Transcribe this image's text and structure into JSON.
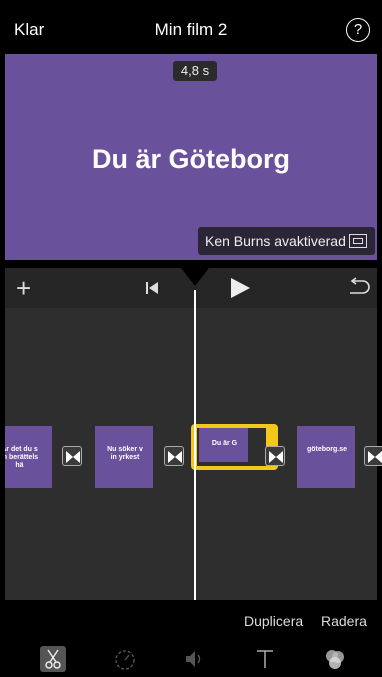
{
  "header": {
    "done_label": "Klar",
    "title": "Min film 2",
    "help_label": "?"
  },
  "preview": {
    "duration": "4,8 s",
    "title_text": "Du är Göteborg",
    "ken_burns_label": "Ken Burns avaktiverad",
    "background_color": "#6a519b"
  },
  "timeline": {
    "clips": [
      {
        "text": "Är det du s\nin berättels\nhä"
      },
      {
        "text": "Nu söker v\nin yrkest"
      },
      {
        "text": "Du är G"
      },
      {
        "text": "göteborg.se"
      }
    ],
    "selected_clip_index": 2,
    "selection_color": "#f3c81c"
  },
  "actions": {
    "duplicate_label": "Duplicera",
    "delete_label": "Radera"
  },
  "toolbar": {
    "tools": [
      "scissors-icon",
      "speed-icon",
      "volume-icon",
      "text-icon",
      "filter-icon"
    ],
    "active_tool": "scissors-icon"
  }
}
